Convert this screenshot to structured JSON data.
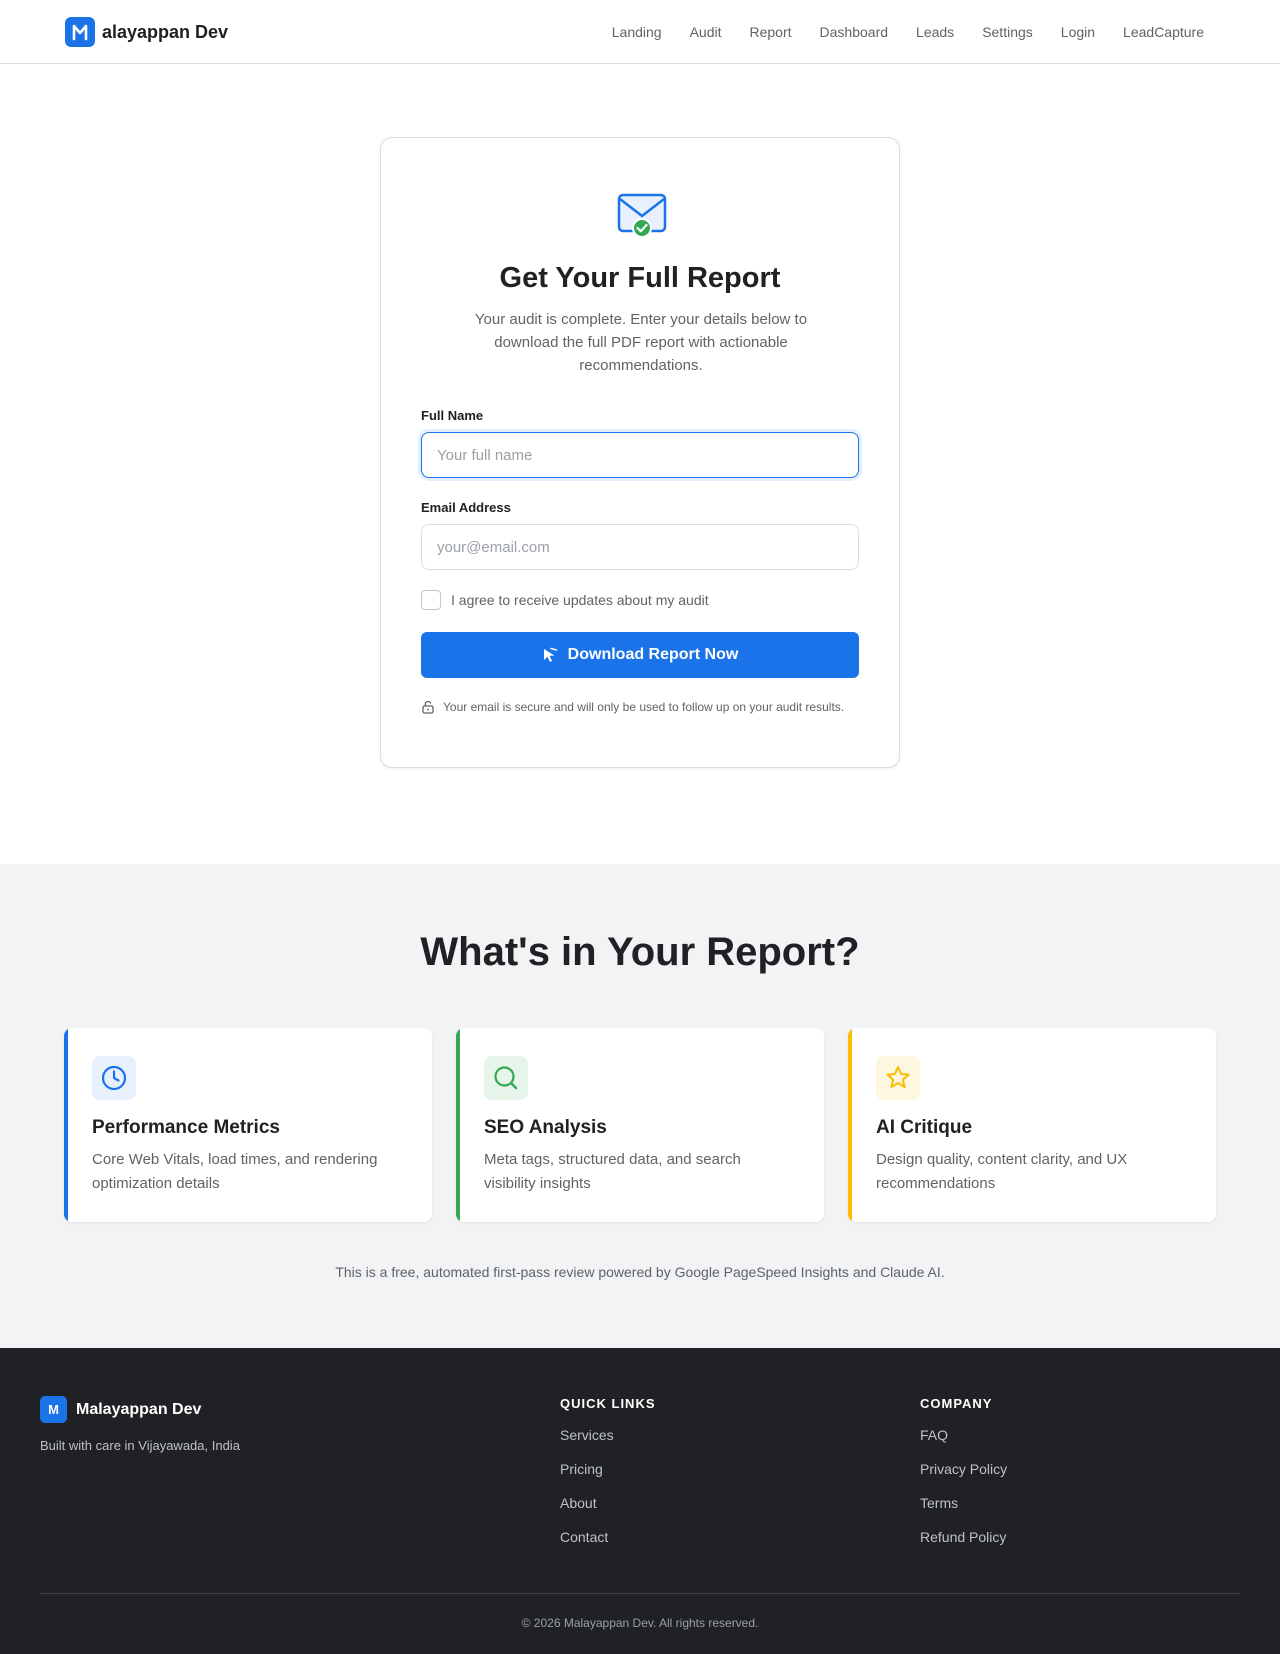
{
  "header": {
    "brand": "alayappan Dev",
    "nav": [
      "Landing",
      "Audit",
      "Report",
      "Dashboard",
      "Leads",
      "Settings",
      "Login",
      "LeadCapture"
    ]
  },
  "form": {
    "title": "Get Your Full Report",
    "subtitle": "Your audit is complete. Enter your details below to download the full PDF report with actionable recommendations.",
    "name_label": "Full Name",
    "name_placeholder": "Your full name",
    "name_value": "",
    "email_label": "Email Address",
    "email_placeholder": "your@email.com",
    "email_value": "",
    "consent_label": "I agree to receive updates about my audit",
    "consent_checked": false,
    "submit_label": "Download Report Now",
    "secure_note": "Your email is secure and will only be used to follow up on your audit results."
  },
  "features": {
    "title": "What's in Your Report?",
    "cards": [
      {
        "title": "Performance Metrics",
        "desc": "Core Web Vitals, load times, and rendering optimization details",
        "icon": "clock-icon",
        "color": "#1a73e8"
      },
      {
        "title": "SEO Analysis",
        "desc": "Meta tags, structured data, and search visibility insights",
        "icon": "search-icon",
        "color": "#34a853"
      },
      {
        "title": "AI Critique",
        "desc": "Design quality, content clarity, and UX recommendations",
        "icon": "star-icon",
        "color": "#fbbc04"
      }
    ],
    "note": "This is a free, automated first-pass review powered by Google PageSpeed Insights and Claude AI."
  },
  "footer": {
    "logo_letter": "M",
    "brand": "Malayappan Dev",
    "tagline": "Built with care in Vijayawada, India",
    "quick_links_title": "QUICK LINKS",
    "quick_links": [
      "Services",
      "Pricing",
      "About",
      "Contact"
    ],
    "company_title": "COMPANY",
    "company_links": [
      "FAQ",
      "Privacy Policy",
      "Terms",
      "Refund Policy"
    ],
    "copyright": "© 2026 Malayappan Dev. All rights reserved."
  },
  "colors": {
    "primary": "#1a73e8",
    "success": "#34a853",
    "warning": "#fbbc04",
    "footer_bg": "#202124"
  }
}
